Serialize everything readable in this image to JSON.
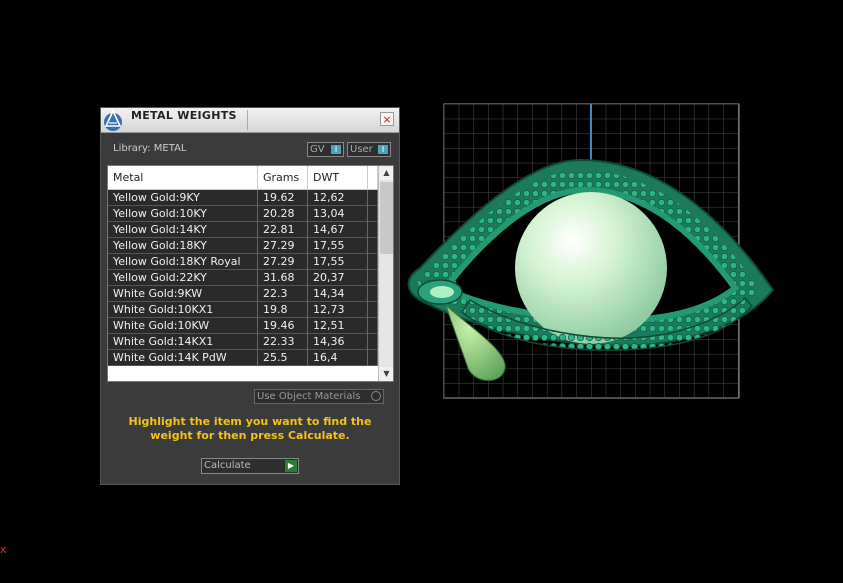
{
  "panel": {
    "title": "METAL WEIGHTS",
    "close_glyph": "×",
    "library_label": "Library: METAL",
    "toggles": [
      {
        "label": "GV",
        "knob": "I"
      },
      {
        "label": "User",
        "knob": "I"
      }
    ],
    "table": {
      "columns": [
        "Metal",
        "Grams",
        "DWT"
      ],
      "rows": [
        [
          "Yellow Gold:9KY",
          "19.62",
          "12,62"
        ],
        [
          "Yellow Gold:10KY",
          "20.28",
          "13,04"
        ],
        [
          "Yellow Gold:14KY",
          "22.81",
          "14,67"
        ],
        [
          "Yellow Gold:18KY",
          "27.29",
          "17,55"
        ],
        [
          "Yellow Gold:18KY Royal",
          "27.29",
          "17,55"
        ],
        [
          "Yellow Gold:22KY",
          "31.68",
          "20,37"
        ],
        [
          "White Gold:9KW",
          "22.3",
          "14,34"
        ],
        [
          "White Gold:10KX1",
          "19.8",
          "12,73"
        ],
        [
          "White Gold:10KW",
          "19.46",
          "12,51"
        ],
        [
          "White Gold:14KX1",
          "22.33",
          "14,36"
        ],
        [
          "White Gold:14K PdW",
          "25.5",
          "16,4"
        ]
      ],
      "scroll_up": "▲",
      "scroll_down": "▼"
    },
    "use_object_materials": "Use Object Materials",
    "hint": "Highlight the item you want to find the weight for then press Calculate.",
    "calculate_label": "Calculate",
    "calculate_glyph": "▶"
  },
  "viewport": {
    "axis_marker": "x",
    "colors": {
      "grid_bg": "#000000",
      "grid_line": "#5a5a5a",
      "ring": "#1e8a6a",
      "pearl": "#bff0c0",
      "axis_blue": "#3a8cc0",
      "axis_red": "#cc2222"
    }
  }
}
